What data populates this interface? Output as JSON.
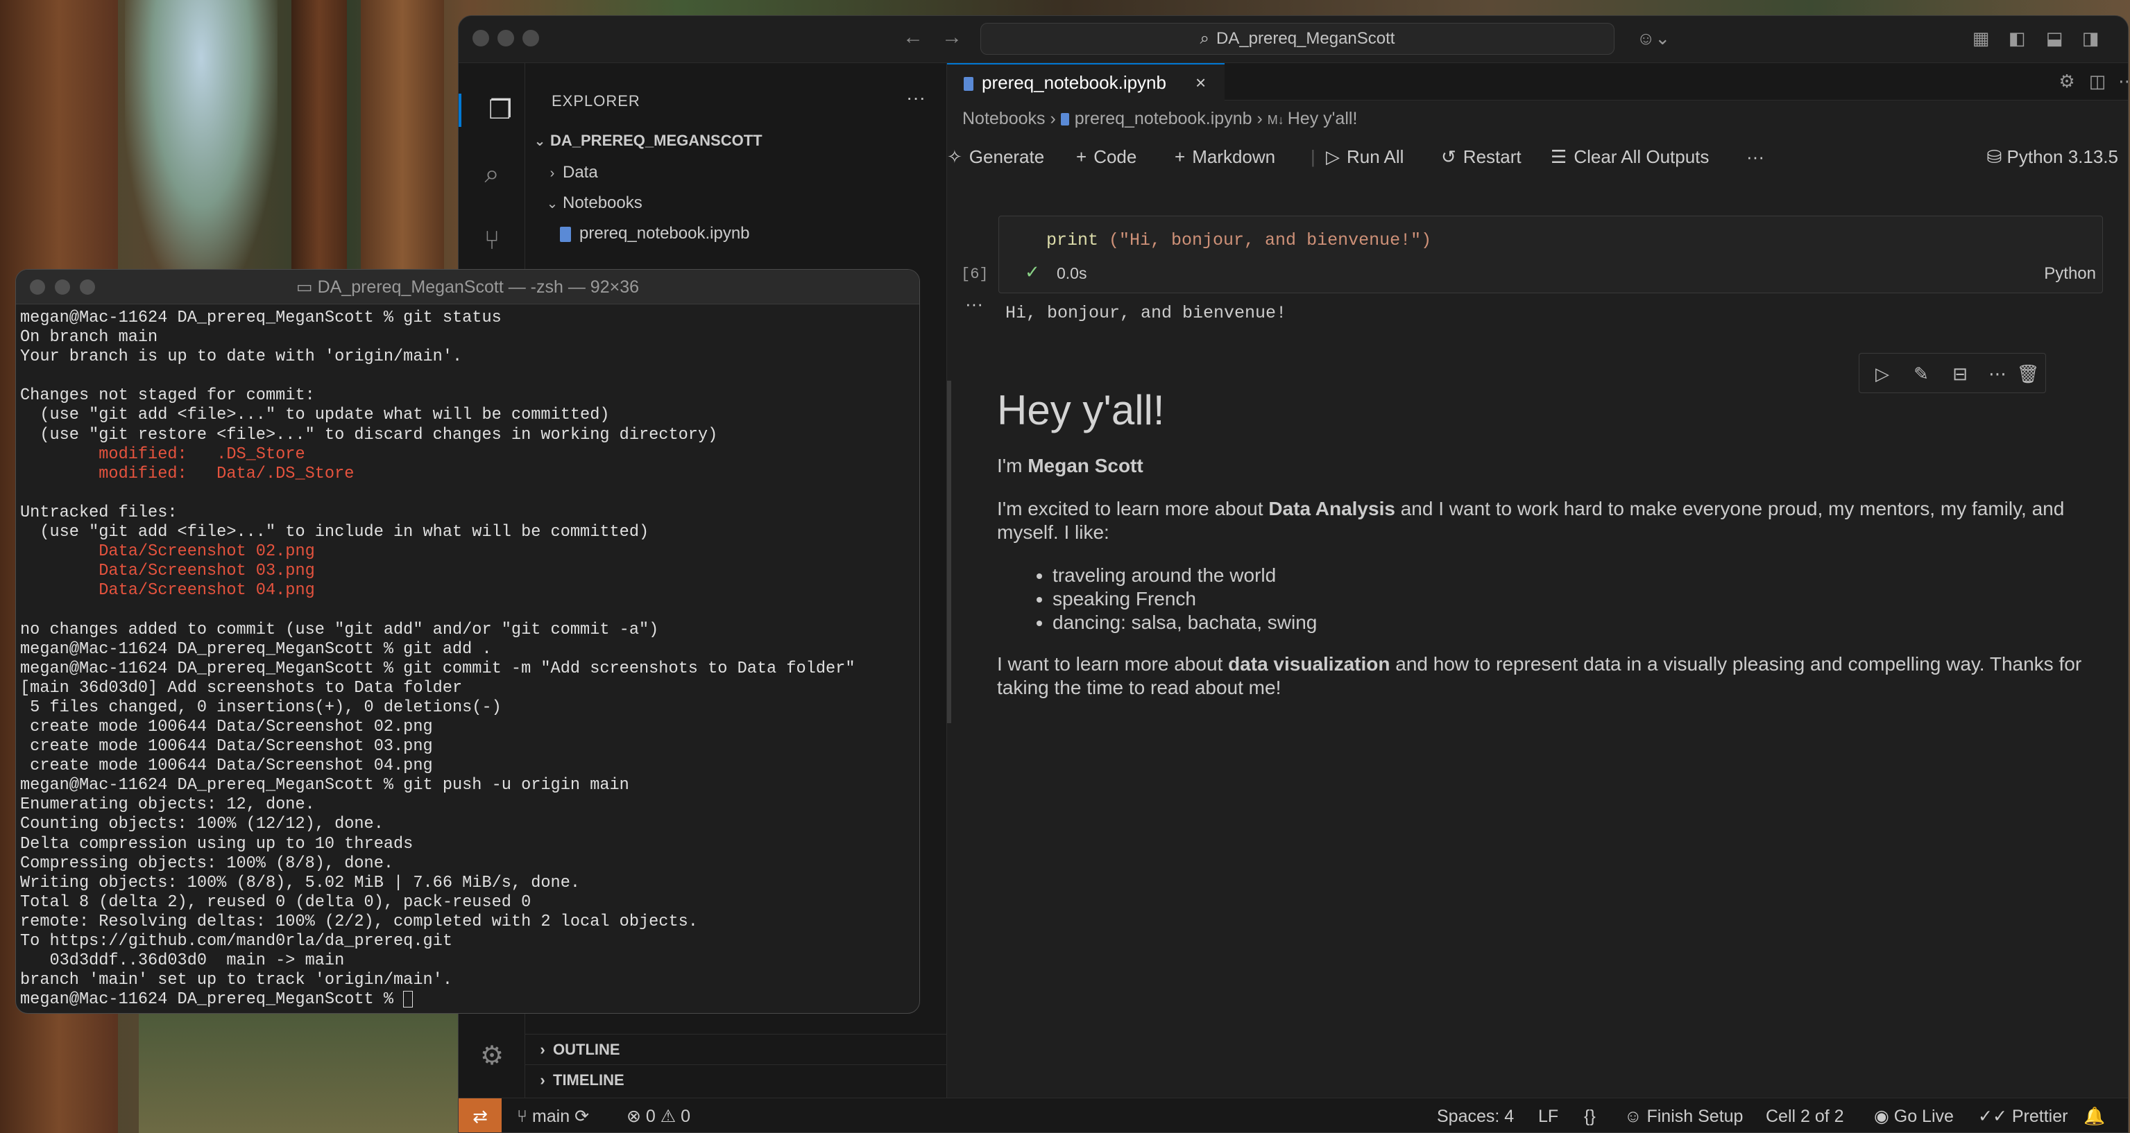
{
  "vscode": {
    "search_text": "DA_prereq_MeganScott",
    "explorer": {
      "title": "EXPLORER",
      "root": "DA_PREREQ_MEGANSCOTT",
      "items": [
        {
          "label": "Data"
        },
        {
          "label": "Notebooks"
        },
        {
          "label": "prereq_notebook.ipynb"
        }
      ],
      "outline": "OUTLINE",
      "timeline": "TIMELINE"
    },
    "tab": {
      "label": "prereq_notebook.ipynb"
    },
    "breadcrumb": {
      "part1": "Notebooks",
      "part2": "prereq_notebook.ipynb",
      "part3": "Hey y'all!"
    },
    "toolbar": {
      "generate": "Generate",
      "code": "Code",
      "markdown": "Markdown",
      "run_all": "Run All",
      "restart": "Restart",
      "clear_all": "Clear All Outputs",
      "kernel": "Python 3.13.5"
    },
    "code_cell": {
      "fn": "print",
      "arg": " (\"Hi, bonjour, and bienvenue!\")",
      "exec_count": "[6]",
      "exec_time": "0.0s",
      "language": "Python",
      "output": "Hi, bonjour, and bienvenue!"
    },
    "markdown": {
      "heading": "Hey y'all!",
      "intro_prefix": "I'm ",
      "intro_name": "Megan Scott",
      "p2_a": "I'm excited to learn more about ",
      "p2_b": "Data Analysis",
      "p2_c": " and I want to work hard to make everyone proud, my mentors, my family, and myself. I like:",
      "likes": [
        "traveling around the world",
        "speaking French",
        "dancing: salsa, bachata, swing"
      ],
      "p3_a": "I want to learn more about ",
      "p3_b": "data visualization",
      "p3_c": " and how to represent data in a visually pleasing and compelling way. Thanks for taking the time to read about me!"
    },
    "status": {
      "branch": "main",
      "errors": "0",
      "warnings": "0",
      "spaces": "Spaces: 4",
      "eol": "LF",
      "braces": "{}",
      "finish_setup": "Finish Setup",
      "cell": "Cell 2 of 2",
      "go_live": "Go Live",
      "prettier": "Prettier"
    }
  },
  "terminal": {
    "title": "DA_prereq_MeganScott — -zsh — 92×36",
    "lines": [
      {
        "t": "megan@Mac-11624 DA_prereq_MeganScott % git status"
      },
      {
        "t": "On branch main"
      },
      {
        "t": "Your branch is up to date with 'origin/main'."
      },
      {
        "t": ""
      },
      {
        "t": "Changes not staged for commit:"
      },
      {
        "t": "  (use \"git add <file>...\" to update what will be committed)"
      },
      {
        "t": "  (use \"git restore <file>...\" to discard changes in working directory)"
      },
      {
        "t": "        modified:   .DS_Store",
        "red": true
      },
      {
        "t": "        modified:   Data/.DS_Store",
        "red": true
      },
      {
        "t": ""
      },
      {
        "t": "Untracked files:"
      },
      {
        "t": "  (use \"git add <file>...\" to include in what will be committed)"
      },
      {
        "t": "        Data/Screenshot 02.png",
        "red": true
      },
      {
        "t": "        Data/Screenshot 03.png",
        "red": true
      },
      {
        "t": "        Data/Screenshot 04.png",
        "red": true
      },
      {
        "t": ""
      },
      {
        "t": "no changes added to commit (use \"git add\" and/or \"git commit -a\")"
      },
      {
        "t": "megan@Mac-11624 DA_prereq_MeganScott % git add ."
      },
      {
        "t": "megan@Mac-11624 DA_prereq_MeganScott % git commit -m \"Add screenshots to Data folder\""
      },
      {
        "t": "[main 36d03d0] Add screenshots to Data folder"
      },
      {
        "t": " 5 files changed, 0 insertions(+), 0 deletions(-)"
      },
      {
        "t": " create mode 100644 Data/Screenshot 02.png"
      },
      {
        "t": " create mode 100644 Data/Screenshot 03.png"
      },
      {
        "t": " create mode 100644 Data/Screenshot 04.png"
      },
      {
        "t": "megan@Mac-11624 DA_prereq_MeganScott % git push -u origin main"
      },
      {
        "t": "Enumerating objects: 12, done."
      },
      {
        "t": "Counting objects: 100% (12/12), done."
      },
      {
        "t": "Delta compression using up to 10 threads"
      },
      {
        "t": "Compressing objects: 100% (8/8), done."
      },
      {
        "t": "Writing objects: 100% (8/8), 5.02 MiB | 7.66 MiB/s, done."
      },
      {
        "t": "Total 8 (delta 2), reused 0 (delta 0), pack-reused 0"
      },
      {
        "t": "remote: Resolving deltas: 100% (2/2), completed with 2 local objects."
      },
      {
        "t": "To https://github.com/mand0rla/da_prereq.git"
      },
      {
        "t": "   03d3ddf..36d03d0  main -> main"
      },
      {
        "t": "branch 'main' set up to track 'origin/main'."
      },
      {
        "t": "megan@Mac-11624 DA_prereq_MeganScott % "
      }
    ]
  }
}
